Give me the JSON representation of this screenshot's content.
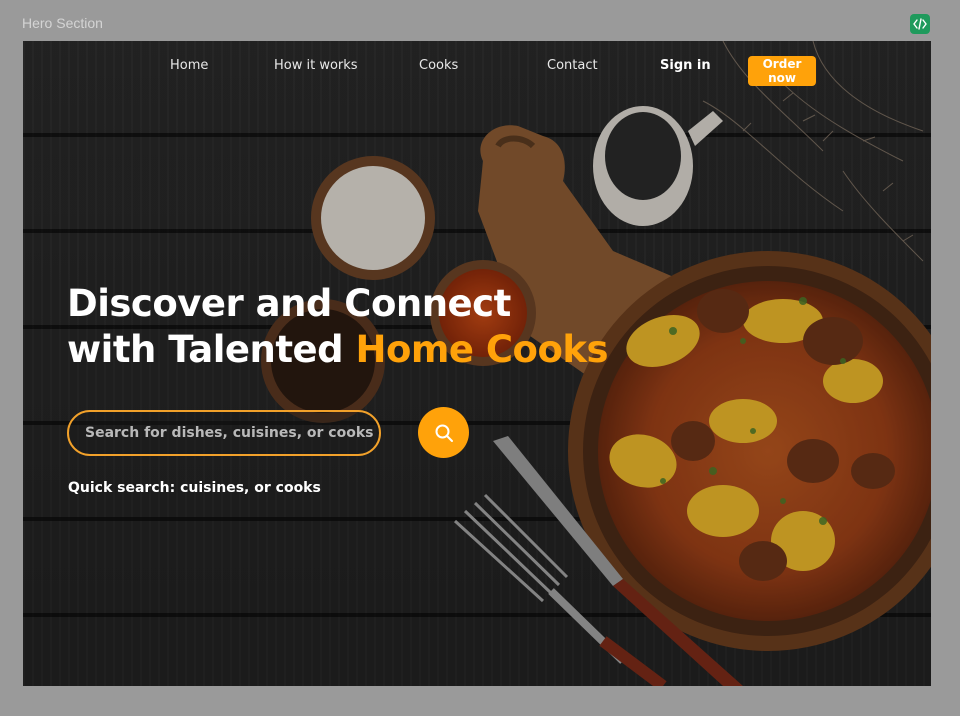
{
  "frame": {
    "label": "Hero Section",
    "code_icon": "code-icon"
  },
  "nav": {
    "items": [
      "Home",
      "How it works",
      "Cooks",
      "Contact"
    ],
    "signin": "Sign in",
    "order": "Order now"
  },
  "hero": {
    "headline_line1": "Discover and Connect",
    "headline_line2_prefix": "with Talented ",
    "headline_line2_accent": "Home Cooks"
  },
  "search": {
    "placeholder": "Search for dishes, cuisines, or cooks",
    "button_icon": "search-icon"
  },
  "quick_search": "Quick search: cuisines, or cooks",
  "colors": {
    "accent": "#ffa20a",
    "frame_badge": "#1f9a5c"
  }
}
